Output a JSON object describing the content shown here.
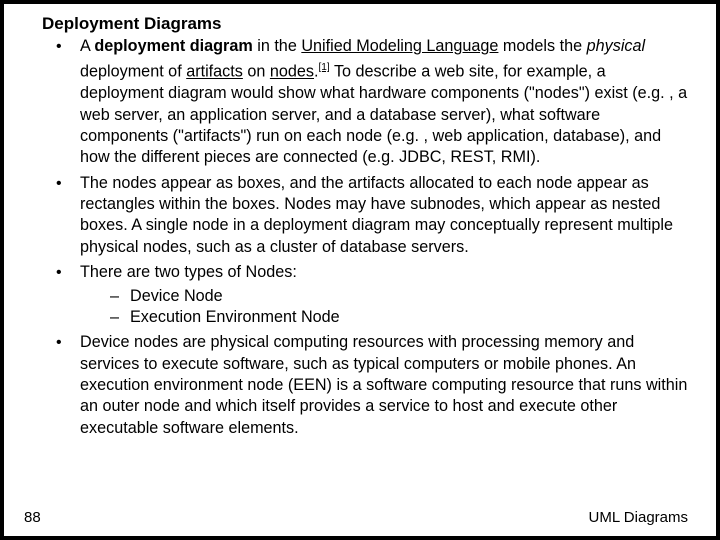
{
  "slide": {
    "title": "Deployment Diagrams",
    "bullets": {
      "b1": {
        "pre": "A ",
        "bold": "deployment diagram",
        "mid1": " in the ",
        "link_uml": "Unified Modeling Language",
        "mid2": " models the ",
        "italic": "physical",
        "mid3": " deployment of ",
        "link_artifacts": "artifacts",
        "mid4": " on ",
        "link_nodes": "nodes",
        "period": ".",
        "ref": "[1]",
        "tail": " To describe a web site, for example, a deployment diagram would show what hardware components (\"nodes\") exist (e.g. , a web server, an application server, and a database server), what software components (\"artifacts\") run on each node (e.g. , web application, database), and how the different pieces are connected (e.g. JDBC, REST, RMI)."
      },
      "b2": "The nodes appear as boxes, and the artifacts allocated to each node appear as rectangles within the boxes. Nodes may have subnodes, which appear as nested boxes. A single node in a deployment diagram may conceptually represent multiple physical nodes, such as a cluster of database servers.",
      "b3": {
        "lead": "There are two types of Nodes:",
        "sub1": "Device Node",
        "sub2": "Execution Environment Node"
      },
      "b4": "Device nodes are physical computing resources with processing memory and services to execute software, such as typical computers or mobile phones. An execution environment node (EEN) is a software computing resource that runs within an outer node and which itself provides a service to host and execute other executable software elements."
    },
    "footer": {
      "page": "88",
      "label": "UML Diagrams"
    }
  }
}
